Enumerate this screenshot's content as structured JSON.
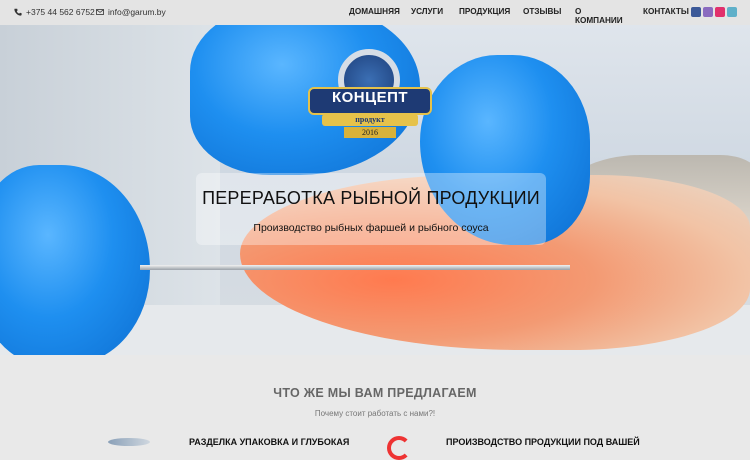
{
  "topbar": {
    "phone": "+375 44 562 6752",
    "email": "info@garum.by",
    "nav": [
      {
        "label": "ДОМАШНЯЯ"
      },
      {
        "label": "УСЛУГИ"
      },
      {
        "label": "ПРОДУКЦИЯ"
      },
      {
        "label": "ОТЗЫВЫ"
      },
      {
        "label": "О КОМПАНИИ"
      },
      {
        "label": "КОНТАКТЫ"
      }
    ],
    "social_colors": [
      "#3b5998",
      "#8a6bbf",
      "#e1306c",
      "#5fb0c9"
    ]
  },
  "hero": {
    "logo_title": "КОНЦЕПТ",
    "logo_subtitle": "продукт",
    "logo_year": "2016",
    "headline": "ПЕРЕРАБОТКА РЫБНОЙ ПРОДУКЦИИ",
    "subline": "Производство рыбных фаршей и рыбного соуса"
  },
  "offer": {
    "title": "ЧТО ЖЕ МЫ ВАМ ПРЕДЛАГАЕМ",
    "subtitle": "Почему стоит работать с нами?!",
    "feature1": "РАЗДЕЛКА УПАКОВКА И ГЛУБОКАЯ",
    "feature2": "ПРОИЗВОДСТВО ПРОДУКЦИИ ПОД ВАШЕЙ"
  },
  "accent": "#1e3a74"
}
